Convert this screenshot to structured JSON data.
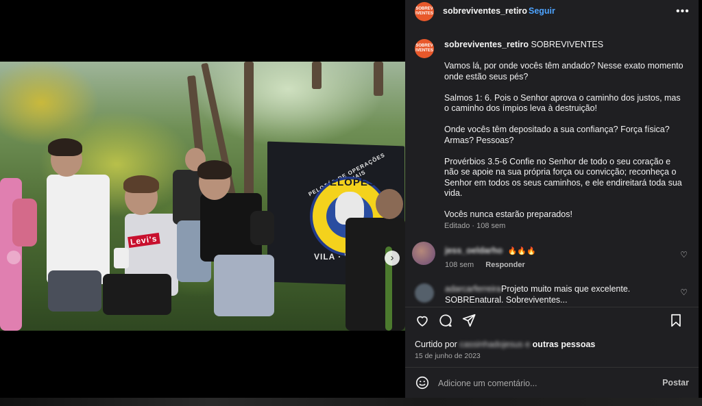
{
  "post": {
    "username": "sobreviventes_retiro",
    "separator": "•",
    "follow_label": "Seguir",
    "avatar_text": "SOBREV IVENTES",
    "more_icon": "more-horizontal-icon"
  },
  "media": {
    "flag_top_text": "PELOTÃO DE OPERAÇÕES ESPECIAIS",
    "flag_name": "PELOPES",
    "flag_bottom_text": "VILA · VELHA · ES",
    "shirt_text": "Levi's",
    "slide_count": 8,
    "active_slide": 7,
    "next_icon": "chevron-right-icon"
  },
  "caption": {
    "username": "sobreviventes_retiro",
    "title": "SOBREVIVENTES",
    "paragraphs": [
      "Vamos lá, por onde vocês têm andado? Nesse exato momento onde estão seus pés?",
      "Salmos 1: 6. Pois o Senhor aprova o caminho dos justos, mas o caminho dos ímpios leva à destruição!",
      "Onde vocês têm depositado a sua confiança? Força física? Armas? Pessoas?",
      "Provérbios 3.5-6 Confie no Senhor de todo o seu coração e não se apoie na sua própria força ou convicção; reconheça o Senhor em todos os seus caminhos, e ele endireitará toda sua vida.",
      "Vocês nunca estarão preparados!"
    ],
    "edited_label": "Editado · 108 sem"
  },
  "comments": [
    {
      "username": "jess_oeldarho",
      "text": "🔥🔥🔥",
      "time": "108 sem",
      "reply_label": "Responder"
    },
    {
      "username": "adarcarferreira",
      "text": "Projeto muito mais que excelente. SOBREnatural. Sobreviventes...",
      "time": "",
      "reply_label": ""
    }
  ],
  "likes": {
    "prefix": "Curtido por",
    "user": "cassinhadojesus e",
    "suffix": "outras pessoas"
  },
  "date": "15 de junho de 2023",
  "comment_box": {
    "placeholder": "Adicione um comentário...",
    "post_label": "Postar"
  },
  "icons": {
    "like": "heart-icon",
    "comment": "comment-icon",
    "share": "send-icon",
    "save": "bookmark-icon",
    "emoji": "smiley-icon"
  },
  "colors": {
    "panel_bg": "#1f1f22",
    "accent_link": "#4da3ff",
    "avatar_bg": "#e8582b"
  }
}
